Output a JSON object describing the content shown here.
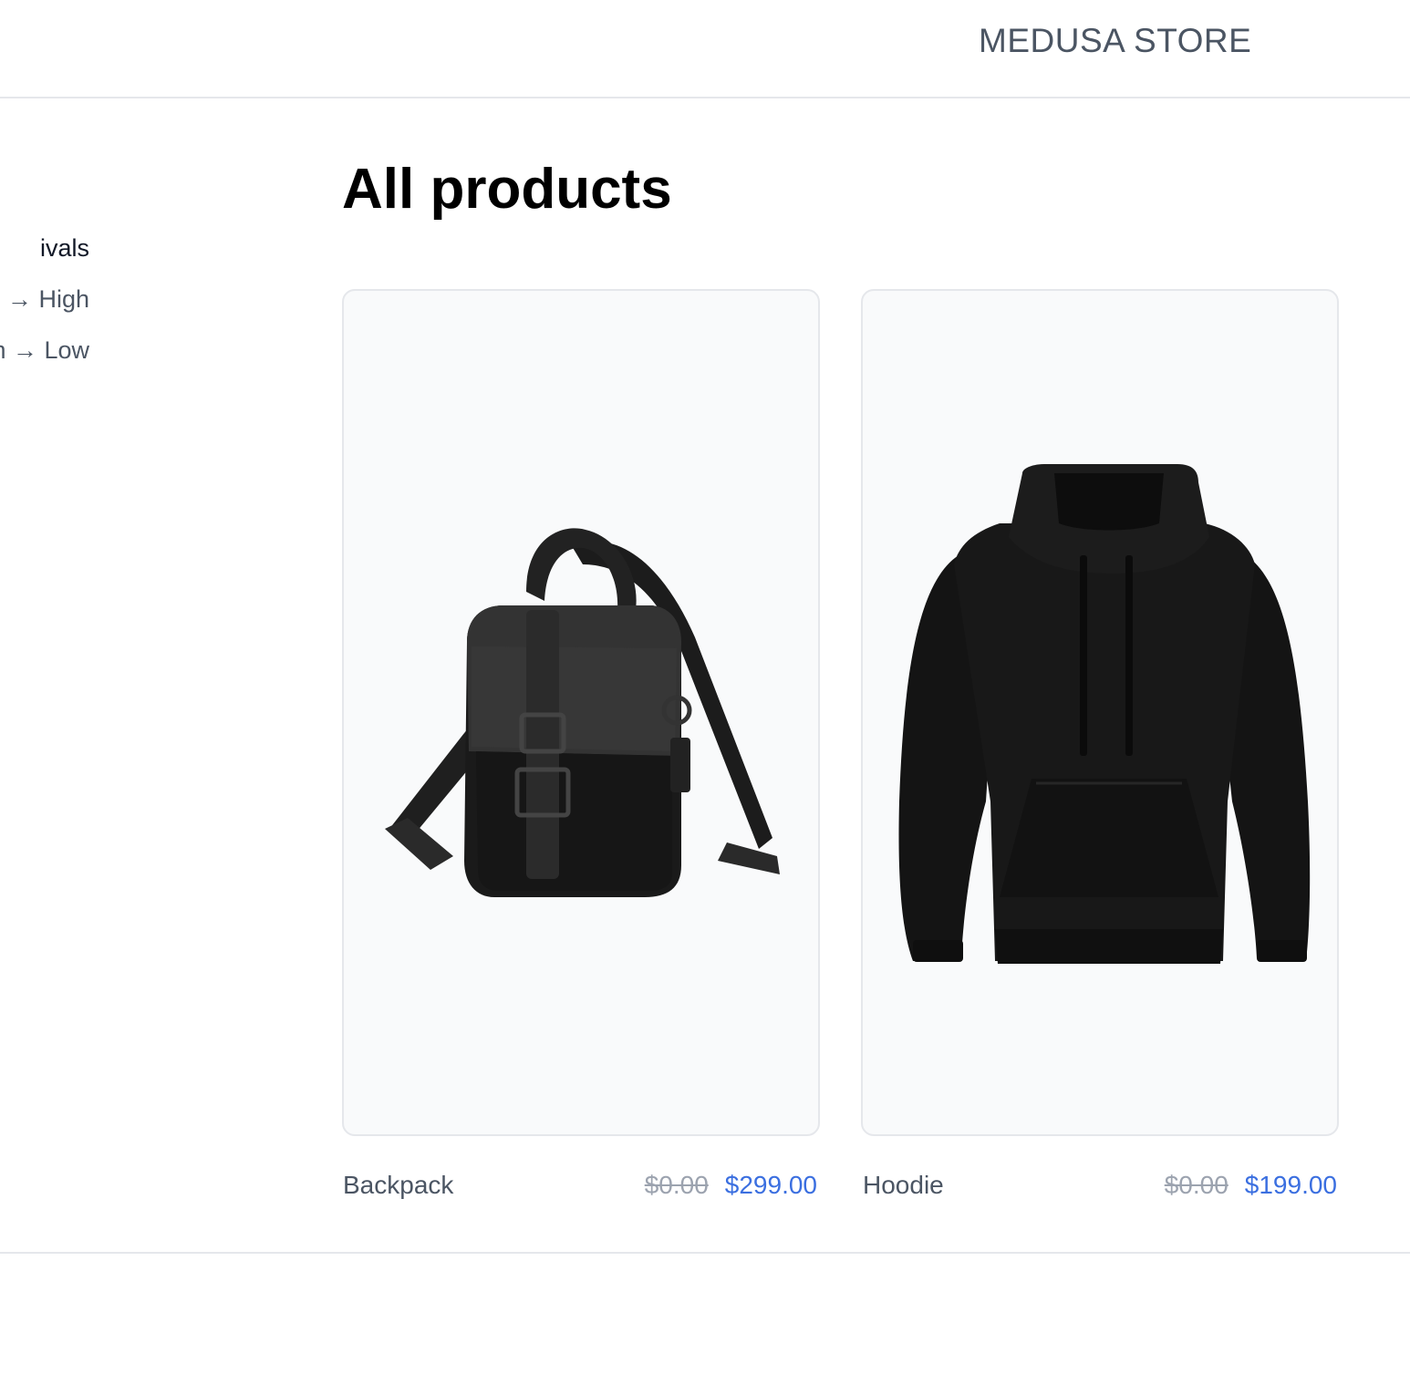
{
  "header": {
    "brand": "MEDUSA STORE"
  },
  "sort": {
    "items": [
      {
        "label": "ivals"
      },
      {
        "label": "→ High"
      },
      {
        "label": "h → Low"
      }
    ]
  },
  "main": {
    "title": "All products",
    "products": [
      {
        "name": "Backpack",
        "original_price": "$0.00",
        "price": "$299.00",
        "image_icon": "backpack-image"
      },
      {
        "name": "Hoodie",
        "original_price": "$0.00",
        "price": "$199.00",
        "image_icon": "hoodie-image"
      }
    ]
  },
  "colors": {
    "price_accent": "#3b6fe0",
    "muted_text": "#4b5563",
    "card_background": "#f9fafb"
  }
}
